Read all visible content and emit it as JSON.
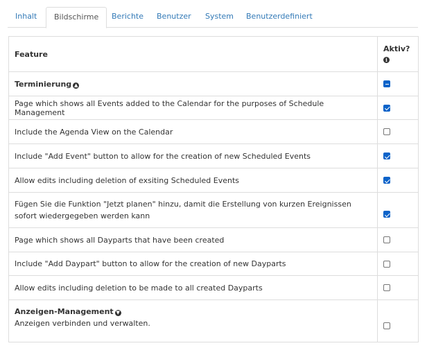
{
  "tabs": [
    {
      "label": "Inhalt",
      "active": false
    },
    {
      "label": "Bildschirme",
      "active": true
    },
    {
      "label": "Berichte",
      "active": false
    },
    {
      "label": "Benutzer",
      "active": false
    },
    {
      "label": "System",
      "active": false
    },
    {
      "label": "Benutzerdefiniert",
      "active": false
    }
  ],
  "table": {
    "header_feature": "Feature",
    "header_active_line1": "Aktiv?",
    "header_active_icon": "info-icon"
  },
  "groups": {
    "terminierung": {
      "title": "Terminierung",
      "toggle_icon": "circle-arrow-up-icon",
      "state": "indeterminate"
    },
    "anzeigen": {
      "title": "Anzeigen-Management",
      "toggle_icon": "circle-arrow-down-icon",
      "description": "Anzeigen verbinden und verwalten.",
      "checked": false
    }
  },
  "rows": [
    {
      "text": "Page which shows all Events added to the Calendar for the purposes of Schedule Management",
      "checked": true
    },
    {
      "text": "Include the Agenda View on the Calendar",
      "checked": false
    },
    {
      "text": "Include \"Add Event\" button to allow for the creation of new Scheduled Events",
      "checked": true
    },
    {
      "text": "Allow edits including deletion of exsiting Scheduled Events",
      "checked": true
    },
    {
      "text": "Fügen Sie die Funktion \"Jetzt planen\" hinzu, damit die Erstellung von kurzen Ereignissen sofort wiedergegeben werden kann",
      "checked": true
    },
    {
      "text": "Page which shows all Dayparts that have been created",
      "checked": false
    },
    {
      "text": "Include \"Add Daypart\" button to allow for the creation of new Dayparts",
      "checked": false
    },
    {
      "text": "Allow edits including deletion to be made to all created Dayparts",
      "checked": false
    }
  ]
}
